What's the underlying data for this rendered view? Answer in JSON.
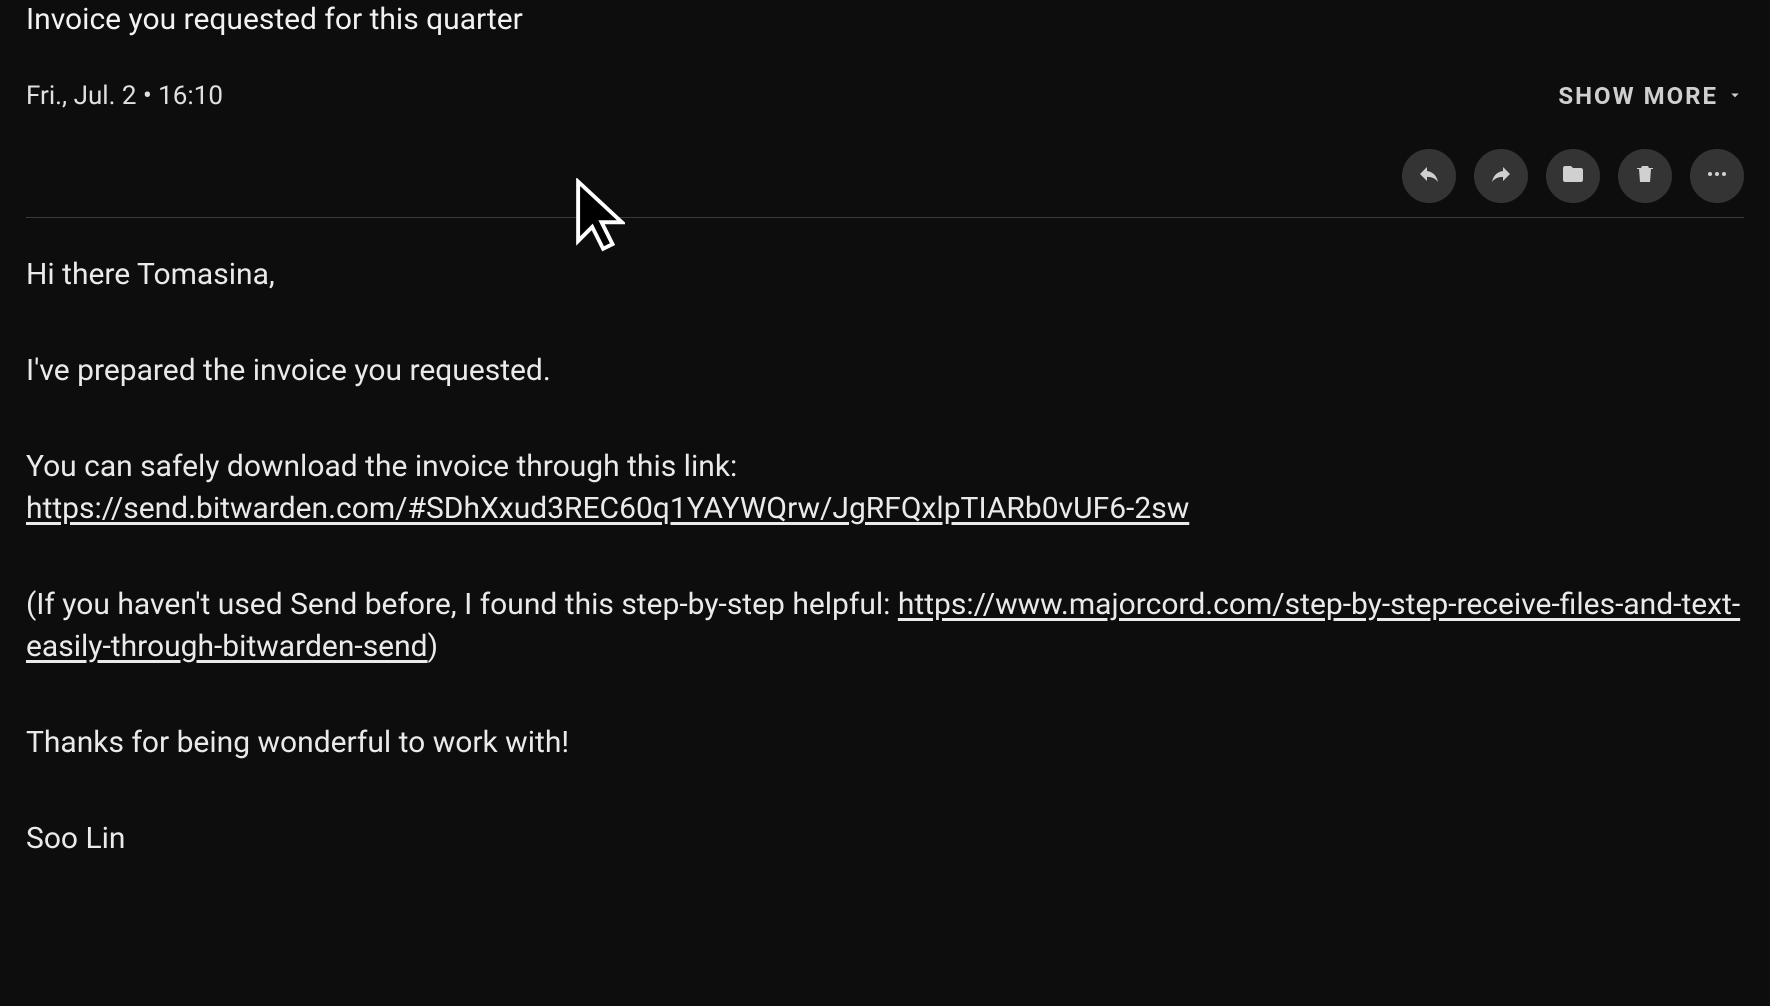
{
  "subject": "Invoice you requested for this quarter",
  "timestamp": "Fri., Jul. 2 • 16:10",
  "show_more_label": "SHOW MORE",
  "actions": {
    "reply": "reply-icon",
    "forward": "forward-icon",
    "archive": "archive-icon",
    "delete": "trash-icon",
    "more": "more-icon"
  },
  "body": {
    "greeting": "Hi there Tomasina,",
    "line1": "I've prepared the invoice you requested.",
    "line2_pre": "You can safely download the invoice through this link: ",
    "line2_link": "https://send.bitwarden.com/#SDhXxud3REC60q1YAYWQrw/JgRFQxlpTIARb0vUF6-2sw",
    "line3_pre": "(If you haven't used Send before, I found this step-by-step helpful: ",
    "line3_link": "https://www.majorcord.com/step-by-step-receive-files-and-text-easily-through-bitwarden-send",
    "line3_post": ")",
    "line4": "Thanks for being wonderful to work with!",
    "signature": "Soo Lin"
  }
}
